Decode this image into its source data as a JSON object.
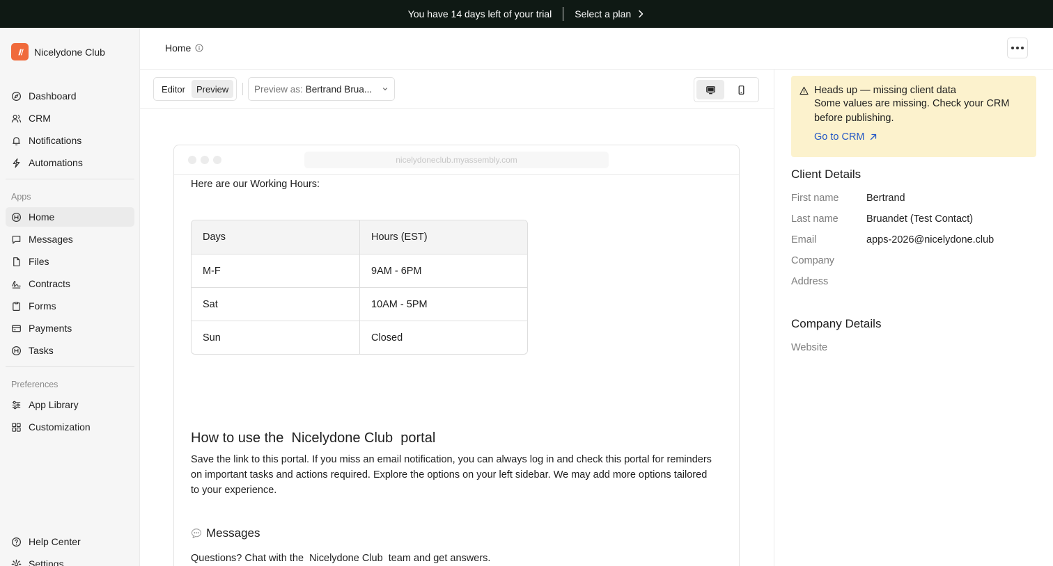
{
  "banner": {
    "trial_text": "You have 14 days left of your trial",
    "cta": "Select a plan"
  },
  "brand": {
    "name": "Nicelydone Club",
    "color": "#f06a3b"
  },
  "sidebar": {
    "main": [
      {
        "label": "Dashboard",
        "icon": "compass-icon"
      },
      {
        "label": "CRM",
        "icon": "users-icon"
      },
      {
        "label": "Notifications",
        "icon": "bell-icon"
      },
      {
        "label": "Automations",
        "icon": "bolt-icon"
      }
    ],
    "apps_label": "Apps",
    "apps": [
      {
        "label": "Home",
        "icon": "home-app-icon",
        "active": true
      },
      {
        "label": "Messages",
        "icon": "message-icon"
      },
      {
        "label": "Files",
        "icon": "file-icon"
      },
      {
        "label": "Contracts",
        "icon": "signature-icon"
      },
      {
        "label": "Forms",
        "icon": "clipboard-icon"
      },
      {
        "label": "Payments",
        "icon": "card-icon"
      },
      {
        "label": "Tasks",
        "icon": "tasks-icon"
      }
    ],
    "prefs_label": "Preferences",
    "prefs": [
      {
        "label": "App Library",
        "icon": "sliders-icon"
      },
      {
        "label": "Customization",
        "icon": "grid-icon"
      }
    ],
    "footer": [
      {
        "label": "Help Center",
        "icon": "help-icon"
      },
      {
        "label": "Settings",
        "icon": "gear-icon"
      }
    ]
  },
  "header": {
    "title": "Home"
  },
  "toolbar": {
    "editor": "Editor",
    "preview": "Preview",
    "preview_as_label": "Preview as:",
    "preview_as_value": "Bertrand Brua..."
  },
  "preview": {
    "url": "nicelydoneclub.myassembly.com",
    "intro": "Here are our Working Hours:",
    "table": {
      "headers": [
        "Days",
        "Hours (EST)"
      ],
      "rows": [
        [
          "M-F",
          "9AM - 6PM"
        ],
        [
          "Sat",
          "10AM - 5PM"
        ],
        [
          "Sun",
          "Closed"
        ]
      ]
    },
    "heading": "How to use the  Nicelydone Club  portal",
    "paragraph": "Save the link to this portal. If you miss an email notification, you can always log in and check this portal for reminders on important tasks and actions required. Explore the options on your left sidebar. We may add more options tailored to your experience.",
    "messages_heading": "Messages",
    "messages_text": "Questions? Chat with the  Nicelydone Club  team and get answers."
  },
  "alert": {
    "title": "Heads up — missing client data",
    "body": "Some values are missing. Check your CRM before publishing.",
    "link": "Go to CRM",
    "bg": "#fcf2cd"
  },
  "client": {
    "title": "Client Details",
    "fields": [
      {
        "k": "First name",
        "v": "Bertrand"
      },
      {
        "k": "Last name",
        "v": "Bruandet (Test Contact)"
      },
      {
        "k": "Email",
        "v": "apps-2026@nicelydone.club"
      },
      {
        "k": "Company",
        "v": ""
      },
      {
        "k": "Address",
        "v": ""
      }
    ]
  },
  "company": {
    "title": "Company Details",
    "fields": [
      {
        "k": "Website",
        "v": ""
      }
    ]
  }
}
